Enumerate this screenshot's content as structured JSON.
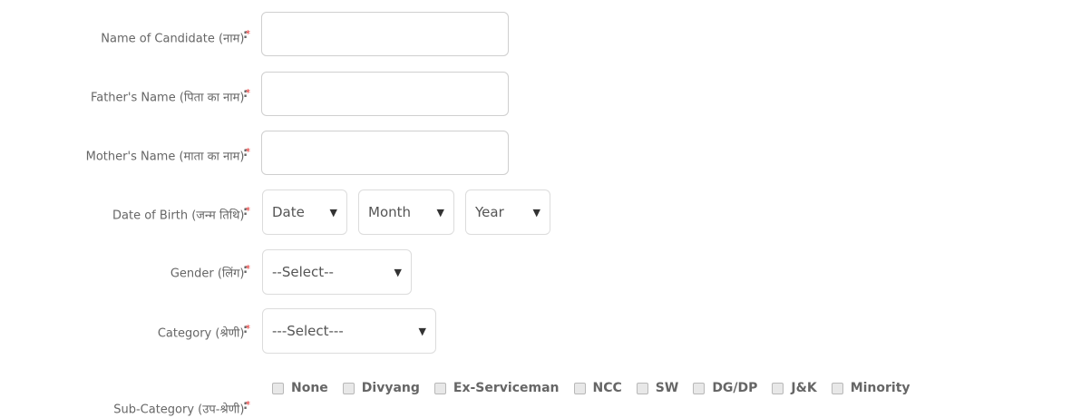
{
  "form": {
    "name": {
      "label": "Name of Candidate (नाम)",
      "required": "*",
      "value": "",
      "placeholder": ""
    },
    "father": {
      "label": "Father's Name (पिता का नाम)",
      "required": "*",
      "value": "",
      "placeholder": ""
    },
    "mother": {
      "label": "Mother's Name (माता का नाम)",
      "required": "*",
      "value": "",
      "placeholder": ""
    },
    "dob": {
      "label": "Date of Birth (जन्म तिथि)",
      "required": "*",
      "date": "Date",
      "month": "Month",
      "year": "Year"
    },
    "gender": {
      "label": "Gender (लिंग)",
      "required": "*",
      "selected": "--Select--"
    },
    "category": {
      "label": "Category (श्रेणी)",
      "required": "*",
      "selected": "---Select---"
    },
    "subcategory": {
      "label": "Sub-Category (उप-श्रेणी)",
      "required": "*",
      "options": [
        "None",
        "Divyang",
        "Ex-Serviceman",
        "NCC",
        "SW",
        "DG/DP",
        "J&K",
        "Minority"
      ]
    },
    "colon": ":"
  },
  "icons": {
    "caret": "caret-down-icon",
    "checkbox": "checkbox-icon"
  },
  "colors": {
    "required": "#e02020",
    "border": "#cfcfcf",
    "text": "#555555"
  }
}
